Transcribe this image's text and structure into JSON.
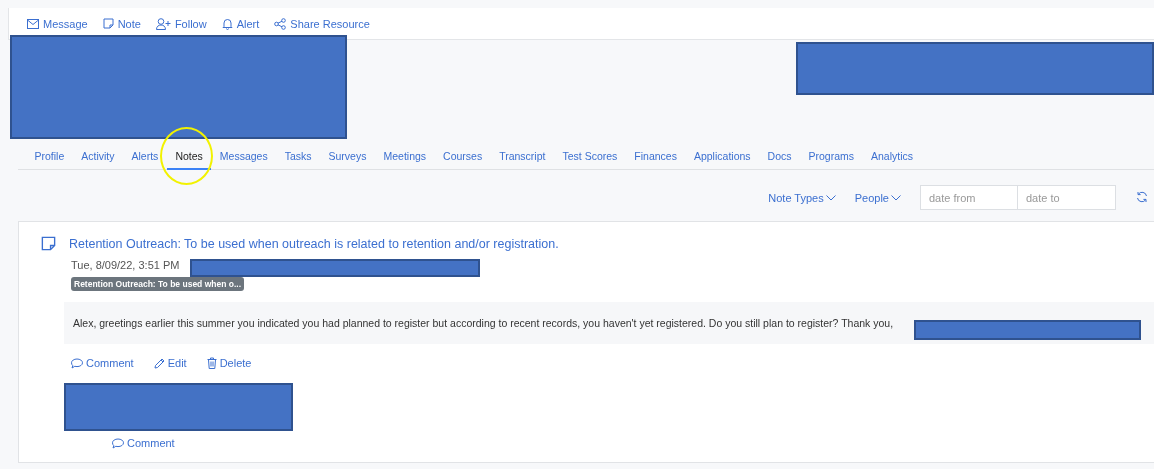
{
  "actions": [
    "Message",
    "Note",
    "Follow",
    "Alert",
    "Share Resource"
  ],
  "tabs": [
    {
      "label": "Profile",
      "selected": false
    },
    {
      "label": "Activity",
      "selected": false
    },
    {
      "label": "Alerts",
      "selected": false
    },
    {
      "label": "Notes",
      "selected": true
    },
    {
      "label": "Messages",
      "selected": false
    },
    {
      "label": "Tasks",
      "selected": false
    },
    {
      "label": "Surveys",
      "selected": false
    },
    {
      "label": "Meetings",
      "selected": false
    },
    {
      "label": "Courses",
      "selected": false
    },
    {
      "label": "Transcript",
      "selected": false
    },
    {
      "label": "Test Scores",
      "selected": false
    },
    {
      "label": "Finances",
      "selected": false
    },
    {
      "label": "Applications",
      "selected": false
    },
    {
      "label": "Docs",
      "selected": false
    },
    {
      "label": "Programs",
      "selected": false
    },
    {
      "label": "Analytics",
      "selected": false
    }
  ],
  "filters": {
    "dropdowns": [
      "Note Types",
      "People"
    ],
    "date_from": {
      "placeholder": "date from"
    },
    "date_to": {
      "placeholder": "date to"
    }
  },
  "note": {
    "title": "Retention Outreach: To be used when outreach is related to retention and/or registration.",
    "timestamp": "Tue, 8/09/22, 3:51 PM",
    "tag": "Retention Outreach: To be used when o...",
    "body": "Alex, greetings earlier this summer you indicated you had planned to register but according to recent records, you haven't yet registered. Do you still plan to register? Thank you,",
    "actions": [
      "Comment",
      "Edit",
      "Delete"
    ],
    "reply_action": "Comment"
  }
}
